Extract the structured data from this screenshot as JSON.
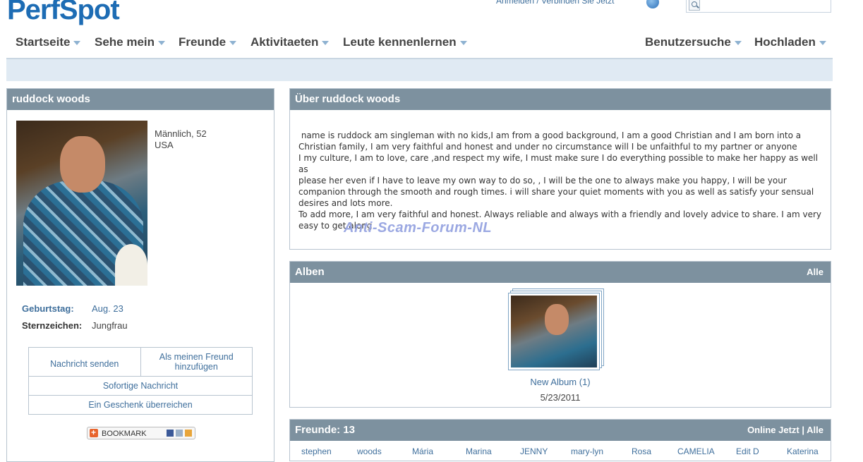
{
  "header": {
    "logo": "PerfSpot",
    "login_link": "Anmelden / Verbinden Sie Jetzt",
    "search": {
      "placeholder": "",
      "icon": "search-icon"
    }
  },
  "nav": {
    "left": [
      "Startseite",
      "Sehe mein",
      "Freunde",
      "Aktivitaeten",
      "Leute kennenlernen"
    ],
    "right": [
      "Benutzersuche",
      "Hochladen"
    ]
  },
  "profile": {
    "name": "ruddock woods",
    "gender_age": "Männlich, 52",
    "country": "USA",
    "birthday_label": "Geburtstag:",
    "birthday_value": "Aug. 23",
    "zodiac_label": "Sternzeichen:",
    "zodiac_value": "Jungfrau",
    "actions": {
      "send_message": "Nachricht senden",
      "add_friend": "Als meinen Freund hinzufügen",
      "instant_message": "Sofortige Nachricht",
      "give_gift": "Ein Geschenk überreichen"
    },
    "bookmark_label": "BOOKMARK"
  },
  "about": {
    "title": "Über ruddock woods",
    "text": " name is ruddock am singleman with no kids,I am from a good background, I am a good Christian and I am born into a\nChristian family, I am very faithful and honest and under no circumstance will I be unfaithful to my partner or anyone\nI my culture, I am to love, care ,and respect my wife, I must make sure I do everything possible to make her happy as well as\nplease her even if I have to leave my own way to do so, , I will be the one to always make you happy, I will be your\ncompanion through the smooth and rough times. i will share your quiet moments with you as well as satisfy your sensual\ndesires and lots more.\nTo add more, I am very faithful and honest. Always reliable and always with a friendly and lovely advice to share. I am very\neasy to get along",
    "watermark": "Anti-Scam-Forum-NL"
  },
  "albums": {
    "title": "Alben",
    "all_link": "Alle",
    "album_name": "New Album (1)",
    "album_date": "5/23/2011"
  },
  "friends": {
    "title": "Freunde: 13",
    "online_link": "Online Jetzt",
    "separator": "|",
    "all_link": "Alle",
    "names": [
      "stephen",
      "woods",
      "Mária",
      "Marina",
      "JENNY",
      "mary-lyn",
      "Rosa",
      "CAMELIA",
      "Edit D",
      "Katerina"
    ]
  },
  "colors": {
    "brand_blue": "#1d6cb4",
    "panel_header": "#7d919f",
    "link_blue": "#3f6f9c",
    "banner": "#e0eaf3"
  }
}
